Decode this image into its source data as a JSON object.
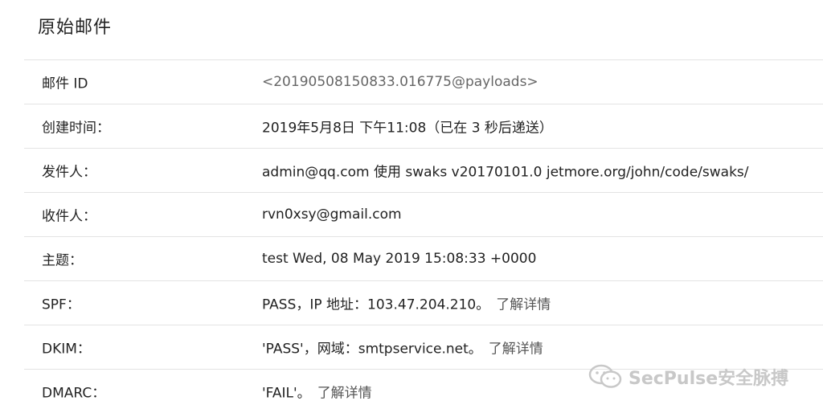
{
  "header": {
    "title": "原始邮件"
  },
  "rows": [
    {
      "label": "邮件 ID",
      "value": "<20190508150833.016775@payloads>"
    },
    {
      "label": "创建时间：",
      "value": "2019年5月8日 下午11:08（已在 3 秒后递送）"
    },
    {
      "label": "发件人：",
      "value": "admin@qq.com 使用 swaks v20170101.0 jetmore.org/john/code/swaks/"
    },
    {
      "label": "收件人：",
      "value": "rvn0xsy@gmail.com"
    },
    {
      "label": "主题：",
      "value": "test Wed, 08 May 2019 15:08:33 +0000"
    },
    {
      "label": "SPF：",
      "value": "PASS，IP 地址：103.47.204.210。",
      "link": "了解详情"
    },
    {
      "label": "DKIM：",
      "value": "'PASS'，网域：smtpservice.net。",
      "link": "了解详情"
    },
    {
      "label": "DMARC：",
      "value": "'FAIL'。",
      "link": "了解详情"
    }
  ],
  "watermark": {
    "text": "SecPulse安全脉搏",
    "icon": "wechat-icon"
  }
}
